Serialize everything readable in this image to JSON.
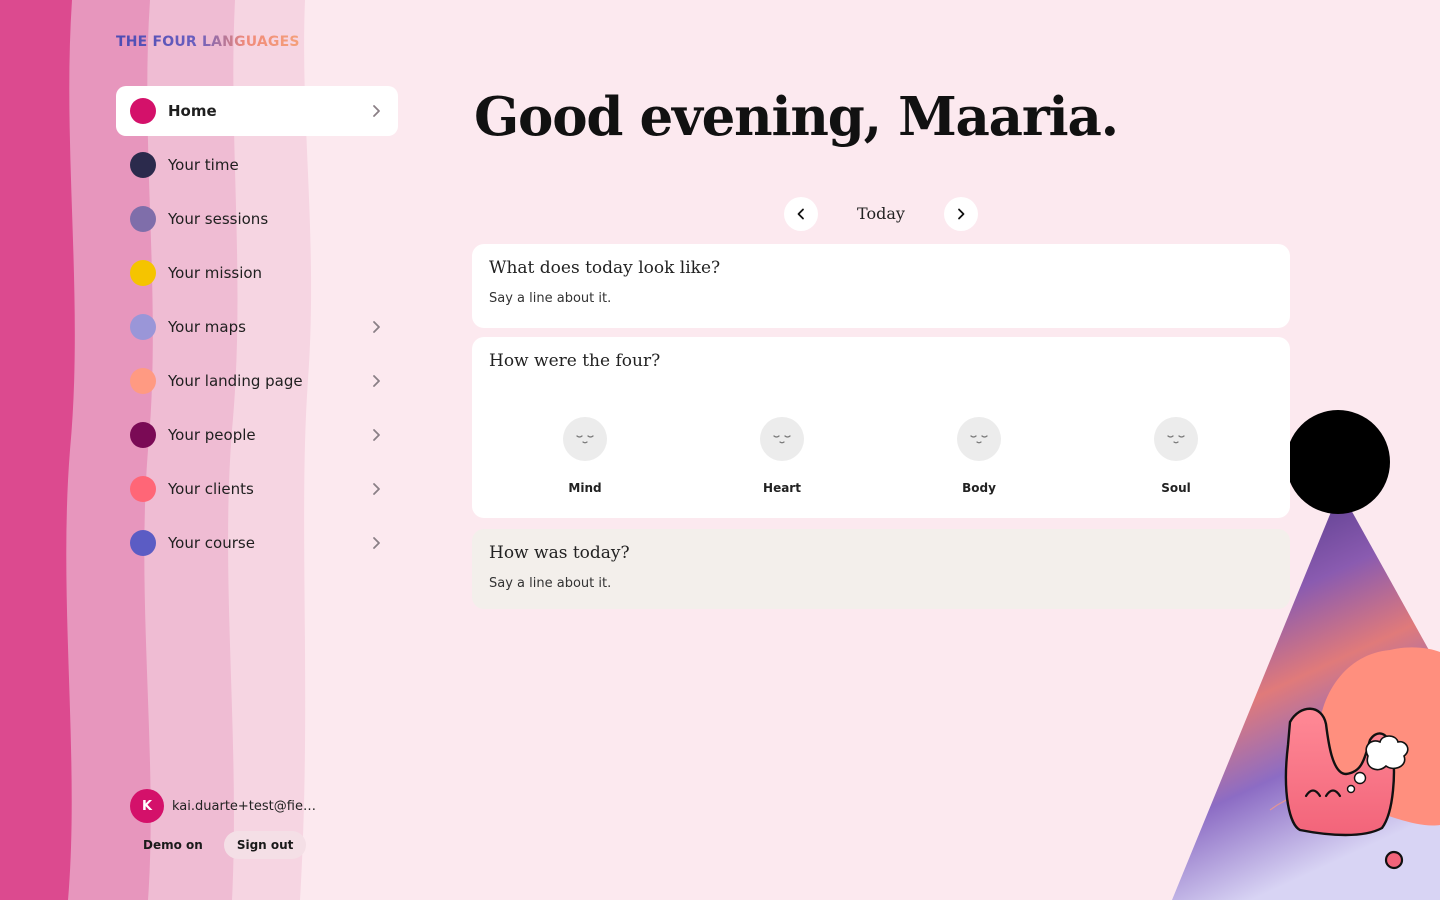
{
  "brand": {
    "name": "THE FOUR LANGUAGES"
  },
  "sidebar": {
    "items": [
      {
        "label": "Home",
        "color": "#d4116a",
        "active": true,
        "has_chevron": true
      },
      {
        "label": "Your time",
        "color": "#2b2a4c",
        "active": false,
        "has_chevron": false
      },
      {
        "label": "Your sessions",
        "color": "#7f6eaa",
        "active": false,
        "has_chevron": false
      },
      {
        "label": "Your mission",
        "color": "#f5c400",
        "active": false,
        "has_chevron": false
      },
      {
        "label": "Your maps",
        "color": "#9a96d8",
        "active": false,
        "has_chevron": true
      },
      {
        "label": "Your landing page",
        "color": "#ff9a82",
        "active": false,
        "has_chevron": true
      },
      {
        "label": "Your people",
        "color": "#7a0a55",
        "active": false,
        "has_chevron": true
      },
      {
        "label": "Your clients",
        "color": "#ff6677",
        "active": false,
        "has_chevron": true
      },
      {
        "label": "Your course",
        "color": "#5b5cc4",
        "active": false,
        "has_chevron": true
      }
    ]
  },
  "account": {
    "avatar_initial": "K",
    "email": "kai.duarte+test@fieldshifting.com",
    "demo_label": "Demo on",
    "signout_label": "Sign out"
  },
  "main": {
    "greeting": "Good evening, Maaria.",
    "date_label": "Today",
    "cards": {
      "today": {
        "title": "What does today look like?",
        "prompt": "Say a line about it."
      },
      "four": {
        "title": "How were the four?",
        "moods": [
          {
            "label": "Mind",
            "icon": "sleepy-face-icon"
          },
          {
            "label": "Heart",
            "icon": "sleepy-face-icon"
          },
          {
            "label": "Body",
            "icon": "sleepy-face-icon"
          },
          {
            "label": "Soul",
            "icon": "sleepy-face-icon"
          }
        ]
      },
      "review": {
        "title": "How was today?",
        "prompt": "Say a line about it."
      }
    }
  },
  "colors": {
    "background": "#fce9ef",
    "accent": "#d4116a"
  }
}
